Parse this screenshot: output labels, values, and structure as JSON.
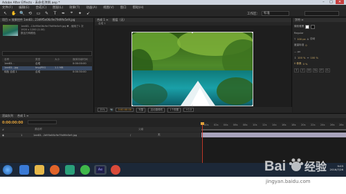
{
  "window": {
    "title": "Adobe After Effects - 未命名项目.aep *",
    "controls": [
      "–",
      "□",
      "✕"
    ]
  },
  "menu": [
    "文件(F)",
    "编辑(E)",
    "合成(C)",
    "图层(L)",
    "效果(T)",
    "动画(A)",
    "视图(V)",
    "窗口",
    "帮助(H)"
  ],
  "toolbar": {
    "tools": [
      "↖",
      "✋",
      "🔍",
      "⟲",
      "▭",
      "✎",
      "T",
      "✒",
      "⌖",
      "✦",
      "➹"
    ],
    "workspace_label": "工作区：",
    "workspace_value": "标准"
  },
  "project": {
    "tab_label": "项目 ≡   效果控件 1ee83...23d9f5e06c9e79d9fe5e9.jpg",
    "info": [
      "1ee83...13d95e06c9e79d9fe5e9.jpg ▼ , 使用了1 次",
      "1920 x 1200 (1.00)",
      "",
      "数百万种颜色"
    ],
    "columns": [
      "名称",
      "类型",
      "大小",
      "媒体持续时间"
    ],
    "rows": [
      {
        "name": "1ee83...",
        "type": "合成",
        "size": "",
        "duration": "0:00:00:00",
        "selected": false
      },
      {
        "name": "1ee83...jpg",
        "type": "ImpJPEG",
        "size": "1.1 MB",
        "duration": "",
        "selected": true
      },
      {
        "name": "纯色 合成 1",
        "type": "合成",
        "size": "",
        "duration": "0:00:30:00",
        "selected": false
      }
    ],
    "footer": "8 bpc"
  },
  "composition": {
    "tabs": [
      "合成 1 ≡",
      "图层（无）"
    ],
    "subtab": "合成 1",
    "footer": [
      "25%",
      "0:00:00:00",
      "完整",
      "活动摄像机",
      "1个视图",
      "+0.0"
    ]
  },
  "right_panel": {
    "tab": "字符 ≡",
    "rows": [
      "微软雅黑",
      "Regular",
      "100 px",
      "自动",
      "度量标准",
      "0",
      "— px",
      "100 %",
      "100 %",
      "0 像素",
      "0 %"
    ],
    "style_buttons": [
      "T",
      "T",
      "TT",
      "Tt",
      "T¹",
      "T₁"
    ]
  },
  "timeline": {
    "tabs": [
      "渲染队列",
      "合成 1 ≡"
    ],
    "timecode": "0:00:00:00",
    "header_cols": [
      "#",
      "源名称",
      "父级"
    ],
    "layer": {
      "index": "1",
      "name": "1ee83...2d95e06c9e79d9fe5e9.jpg",
      "parent": "无"
    },
    "ruler": [
      "00s",
      "02s",
      "04s",
      "06s",
      "08s",
      "10s",
      "12s",
      "14s",
      "16s",
      "18s",
      "20s",
      "22s",
      "24s",
      "26s",
      "28s"
    ]
  },
  "taskbar": {
    "time": "9:03",
    "date": "2016/7/26"
  },
  "watermark": {
    "logo_text": "Baidu 经验",
    "url": "jingyan.baidu.com"
  },
  "colors": {
    "accent_timecode": "#e0a03a",
    "layer_bar": "#a9a4bc",
    "playhead": "#c0392b"
  }
}
